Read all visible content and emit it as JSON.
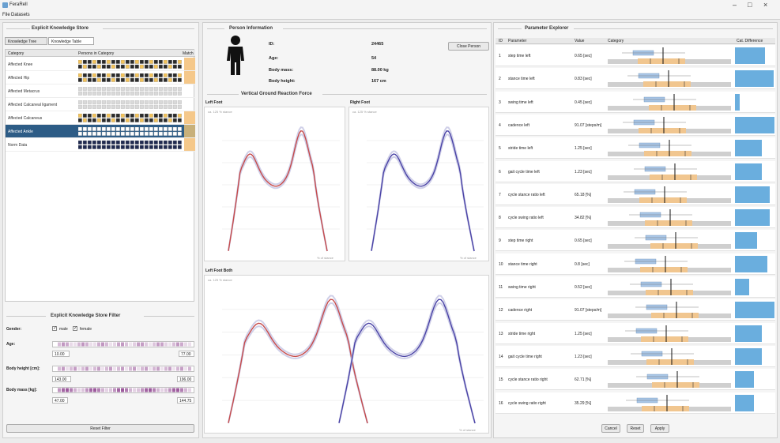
{
  "window": {
    "title": "FeraRell",
    "menu": [
      "File",
      "Datasets"
    ]
  },
  "left": {
    "store_title": "Explicit Knowledge Store",
    "tabs": [
      "Knowledge Tree",
      "Knowledge Table"
    ],
    "grid_headers": [
      "Category",
      "Persons in Category",
      "Match"
    ],
    "rows": [
      {
        "label": "Affected Knee",
        "fill": 0.8,
        "selected": false
      },
      {
        "label": "Affected Hip",
        "fill": 0.8,
        "selected": false
      },
      {
        "label": "Affected Metacrus",
        "fill": 0.0,
        "selected": false
      },
      {
        "label": "Affected Calcaneal ligament",
        "fill": 0.0,
        "selected": false
      },
      {
        "label": "Affected Calcaneus",
        "fill": 0.8,
        "selected": false
      },
      {
        "label": "Affected Ankle",
        "fill": 0.0,
        "selected": true
      },
      {
        "label": "Norm Data",
        "fill": 1.0,
        "selected": false
      }
    ],
    "filter_title": "Explicit Knowledge Store Filter",
    "gender_label": "Gender:",
    "male_label": "male",
    "female_label": "female",
    "age_label": "Age:",
    "age_min": "10.00",
    "age_max": "77.00",
    "height_label": "Body height [cm]:",
    "height_min": "143.00",
    "height_max": "196.00",
    "mass_label": "Body mass [kg]:",
    "mass_min": "47.00",
    "mass_max": "144.75",
    "reset_filter": "Reset Filter"
  },
  "middle": {
    "person_title": "Person Information",
    "id_label": "ID:",
    "id_value": "24465",
    "age_label": "Age:",
    "age_value": "54",
    "mass_label": "Body mass:",
    "mass_value": "88.00 kg",
    "height_label": "Body height:",
    "height_value": "167 cm",
    "close_person": "Close Person",
    "grf_title": "Vertical Ground Reaction Force",
    "left_foot": "Left Foot",
    "right_foot": "Right Foot",
    "both_feet": "Left Foot Both",
    "axis_note": "ca. 125 % stance",
    "x_note": "% of stance"
  },
  "right": {
    "title": "Parameter Explorer",
    "headers": [
      "ID",
      "Parameter",
      "Value",
      "Category",
      "Cat. Difference"
    ],
    "rows": [
      {
        "idx": "1",
        "name": "step time left",
        "value": "0.65 [sec]",
        "diff": 0.75
      },
      {
        "idx": "2",
        "name": "stance time left",
        "value": "0.83 [sec]",
        "diff": 0.98
      },
      {
        "idx": "3",
        "name": "swing time left",
        "value": "0.45 [sec]",
        "diff": 0.12
      },
      {
        "idx": "4",
        "name": "cadence left",
        "value": "91.07 [steps/m]",
        "diff": 1.0
      },
      {
        "idx": "5",
        "name": "stride time left",
        "value": "1.25 [sec]",
        "diff": 0.68
      },
      {
        "idx": "6",
        "name": "gait cycle time left",
        "value": "1.23 [sec]",
        "diff": 0.68
      },
      {
        "idx": "7",
        "name": "cycle stance ratio left",
        "value": "65.18 [%]",
        "diff": 0.88
      },
      {
        "idx": "8",
        "name": "cycle swing ratio left",
        "value": "34.82 [%]",
        "diff": 0.88
      },
      {
        "idx": "9",
        "name": "step time right",
        "value": "0.65 [sec]",
        "diff": 0.55
      },
      {
        "idx": "10",
        "name": "stance time right",
        "value": "0.8 [sec]",
        "diff": 0.82
      },
      {
        "idx": "11",
        "name": "swing time right",
        "value": "0.52 [sec]",
        "diff": 0.35
      },
      {
        "idx": "12",
        "name": "cadence right",
        "value": "91.07 [steps/m]",
        "diff": 1.0
      },
      {
        "idx": "13",
        "name": "stride time right",
        "value": "1.25 [sec]",
        "diff": 0.68
      },
      {
        "idx": "14",
        "name": "gait cycle time right",
        "value": "1.23 [sec]",
        "diff": 0.68
      },
      {
        "idx": "15",
        "name": "cycle stance ratio right",
        "value": "62.71 [%]",
        "diff": 0.48
      },
      {
        "idx": "16",
        "name": "cycle swing ratio right",
        "value": "35.29 [%]",
        "diff": 0.48
      }
    ],
    "cancel": "Cancel",
    "reset": "Reset",
    "apply": "Apply"
  },
  "colors": {
    "left_curve": "#c64b4b",
    "right_curve": "#4a43a6",
    "selection": "#2d5c86",
    "match_bar": "#f5c88a",
    "diff_bar": "#6aaede"
  }
}
